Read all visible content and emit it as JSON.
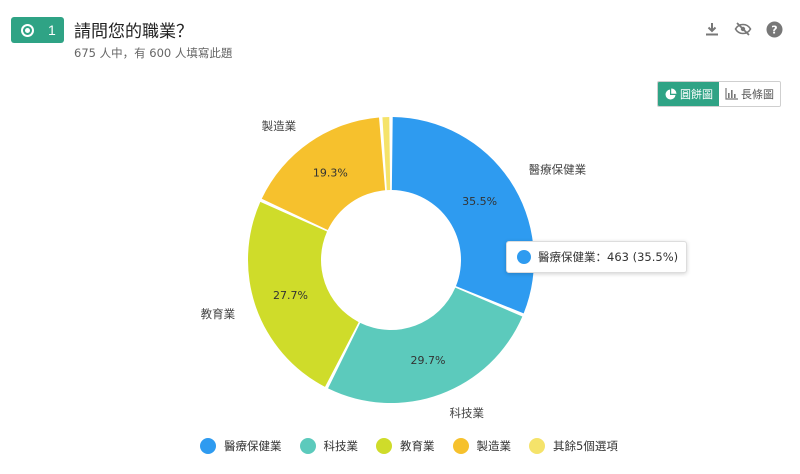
{
  "question": {
    "number": "1",
    "title": "請問您的職業？",
    "subtitle": "675 人中，有 600 人填寫此題"
  },
  "toolbar": {
    "download_icon": "download-icon",
    "hide_icon": "eye-off-icon",
    "help_icon": "help-icon"
  },
  "view_toggle": {
    "pie_label": "圓餅圖",
    "bar_label": "長條圖"
  },
  "tooltip": {
    "text": "醫療保健業：463 (35.5%)"
  },
  "legend": [
    {
      "label": "醫療保健業",
      "color": "#2e9bf0"
    },
    {
      "label": "科技業",
      "color": "#5ccabc"
    },
    {
      "label": "教育業",
      "color": "#cfdc2a"
    },
    {
      "label": "製造業",
      "color": "#f6c12d"
    },
    {
      "label": "其餘5個選項",
      "color": "#f5e36a"
    }
  ],
  "chart_data": {
    "type": "pie",
    "variant": "donut",
    "series": [
      {
        "name": "醫療保健業",
        "value": 463,
        "percent_label": "35.5%",
        "color": "#2e9bf0"
      },
      {
        "name": "科技業",
        "percent": 29.7,
        "percent_label": "29.7%",
        "color": "#5ccabc"
      },
      {
        "name": "教育業",
        "percent": 27.7,
        "percent_label": "27.7%",
        "color": "#cfdc2a"
      },
      {
        "name": "製造業",
        "percent": 19.3,
        "percent_label": "19.3%",
        "color": "#f6c12d"
      },
      {
        "name": "其餘5個選項",
        "percent": 1.3,
        "color": "#f5e36a"
      }
    ],
    "legend_position": "bottom"
  }
}
